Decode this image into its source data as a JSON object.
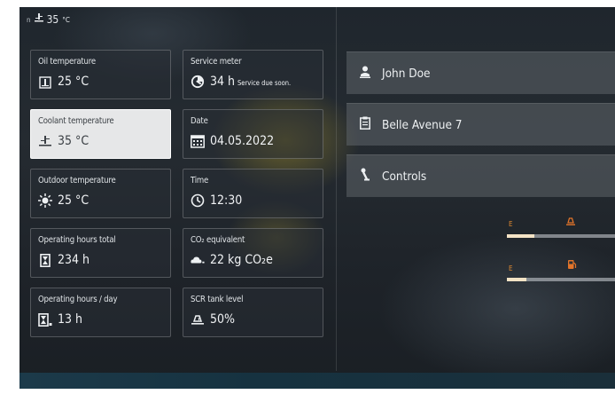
{
  "status_bar": {
    "prefix": "n",
    "value": "35",
    "unit": "°C"
  },
  "tiles": {
    "oil_temperature": {
      "label": "Oil temperature",
      "value": "25 °C",
      "icon": "oil-thermometer-icon"
    },
    "service_meter": {
      "label": "Service meter",
      "value": "34 h",
      "note": "Service due soon.",
      "icon": "service-wrench-icon"
    },
    "coolant_temperature": {
      "label": "Coolant temperature",
      "value": "35 °C",
      "icon": "coolant-thermometer-icon"
    },
    "date": {
      "label": "Date",
      "value": "04.05.2022",
      "icon": "calendar-icon"
    },
    "outdoor_temperature": {
      "label": "Outdoor temperature",
      "value": "25 °C",
      "icon": "sun-icon"
    },
    "time": {
      "label": "Time",
      "value": "12:30",
      "icon": "clock-icon"
    },
    "operating_hours_total": {
      "label": "Operating hours total",
      "value": "234 h",
      "icon": "hourglass-icon"
    },
    "co2_equivalent": {
      "label": "CO₂ equivalent",
      "value": "22 kg CO₂e",
      "icon": "co2-cloud-icon"
    },
    "operating_hours_day": {
      "label": "Operating hours / day",
      "value": "13 h",
      "icon": "hourglass-day-icon"
    },
    "scr_tank_level": {
      "label": "SCR tank level",
      "value": "50%",
      "icon": "scr-tank-icon"
    }
  },
  "menu": [
    {
      "label": "John Doe",
      "icon": "user-icon"
    },
    {
      "label": "Belle Avenue 7",
      "icon": "clipboard-icon"
    },
    {
      "label": "Controls",
      "icon": "joystick-icon"
    }
  ],
  "gauges": [
    {
      "letter": "E",
      "icon": "scr-fluid-icon",
      "level": 0.25
    },
    {
      "letter": "E",
      "icon": "fuel-pump-icon",
      "level": 0.18
    }
  ],
  "colors": {
    "accent": "#e2742a",
    "selected_tile": "#e6e7e8",
    "menu_bg": "#5f6469"
  }
}
